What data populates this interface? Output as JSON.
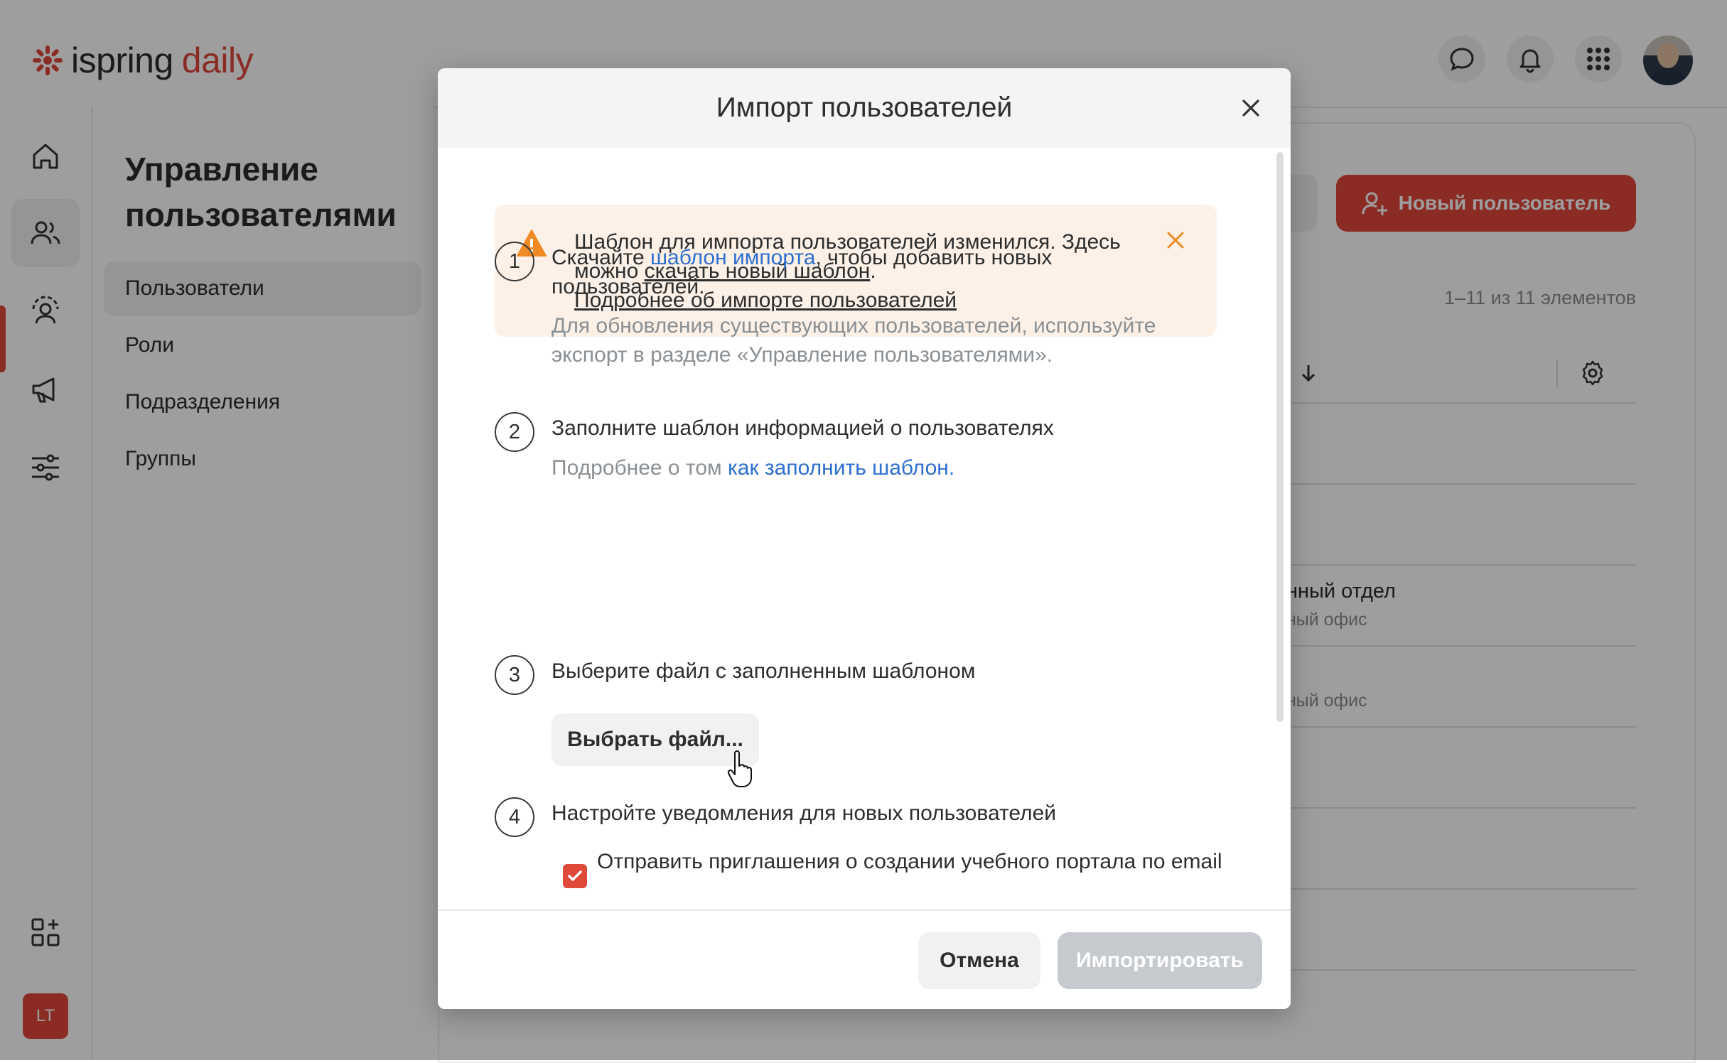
{
  "app": {
    "logo_part1": "ispring",
    "logo_part2": "daily",
    "user_initials": "LT",
    "accent_color": "#e0483a"
  },
  "sidebar_nav": [
    "home-icon",
    "users-icon",
    "person-gear-icon",
    "megaphone-icon",
    "sliders-icon",
    "add-widget-icon"
  ],
  "side_panel": {
    "title": "Управление пользователями",
    "items": [
      {
        "label": "Пользователи",
        "selected": true
      },
      {
        "label": "Роли",
        "selected": false
      },
      {
        "label": "Подразделения",
        "selected": false
      },
      {
        "label": "Группы",
        "selected": false
      }
    ]
  },
  "page": {
    "new_user_button": "Новый пользователь",
    "count_text": "1–11 из 11 элементов",
    "rows": [
      {
        "primary": "нный отдел",
        "secondary": "ный офис"
      },
      {
        "primary": "",
        "secondary": "ный офис"
      }
    ]
  },
  "modal": {
    "title": "Импорт пользователей",
    "alert": {
      "text_before": "Шаблон для импорта пользователей изменился. Здесь можно ",
      "link1": "скачать новый шаблон",
      "text_after": ".",
      "link2": "Подробнее об импорте пользователей"
    },
    "steps": [
      {
        "number": "1",
        "text_before": "Скачайте ",
        "link": "шаблон импорта",
        "text_after": ", чтобы добавить новых пользователей.",
        "sub": "Для обновления существующих пользователей, используйте экспорт в разделе «Управление пользователями»."
      },
      {
        "number": "2",
        "text": "Заполните шаблон информацией о пользователях",
        "sub_before": "Подробнее о том ",
        "sub_link": "как заполнить шаблон",
        "sub_after": "."
      },
      {
        "number": "3",
        "text": "Выберите файл с заполненным шаблоном",
        "button": "Выбрать файл..."
      },
      {
        "number": "4",
        "text": "Настройте уведомления для новых пользователей",
        "checkbox_label": "Отправить приглашения о создании учебного портала по email",
        "checkbox_checked": true
      }
    ],
    "cancel_button": "Отмена",
    "import_button": "Импортировать"
  }
}
